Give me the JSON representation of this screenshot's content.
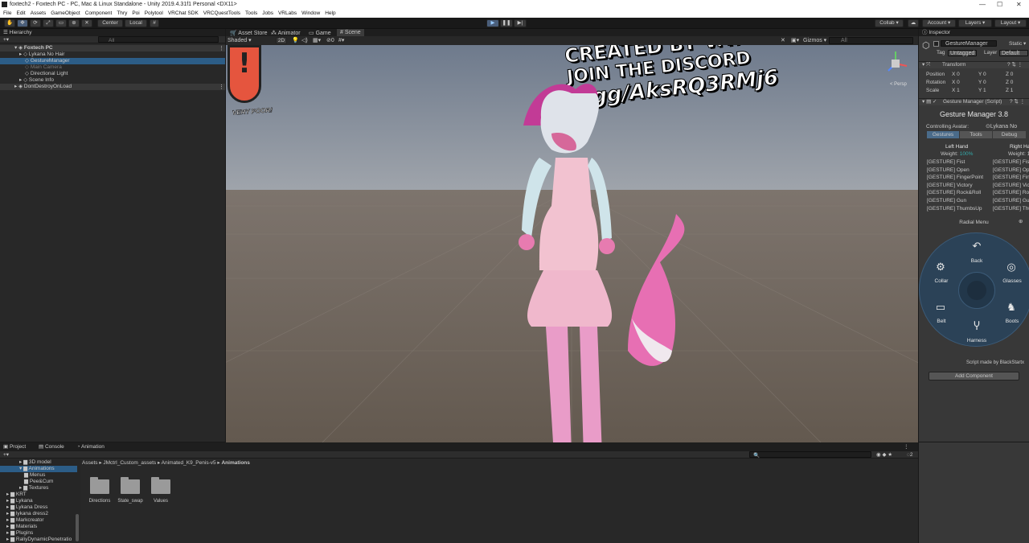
{
  "window": {
    "title": "foxtech2 - Foxtech PC - PC, Mac & Linux Standalone - Unity 2019.4.31f1 Personal <DX11>",
    "controls": [
      "—",
      "☐",
      "✕"
    ]
  },
  "menu": [
    "File",
    "Edit",
    "Assets",
    "GameObject",
    "Component",
    "Thry",
    "Poi",
    "Polytool",
    "VRChat SDK",
    "VRCQuestTools",
    "Tools",
    "Jobs",
    "VRLabs",
    "Window",
    "Help"
  ],
  "toolbar": {
    "center": "Center",
    "local": "Local",
    "collab": "Collab ▾",
    "account": "Account ▾",
    "layers": "Layers ▾",
    "layout": "Layout ▾"
  },
  "hierarchy": {
    "tab": "Hierarchy",
    "search_placeholder": "All",
    "items": [
      {
        "label": "Foxtech PC",
        "indent": 0,
        "bold": true
      },
      {
        "label": "Lykana No Hair",
        "indent": 1
      },
      {
        "label": "GestureManager",
        "indent": 1,
        "selected": true
      },
      {
        "label": "Main Camera",
        "indent": 1,
        "dim": true
      },
      {
        "label": "Directional Light",
        "indent": 1
      },
      {
        "label": "Scene Info",
        "indent": 1
      },
      {
        "label": "DontDestroyOnLoad",
        "indent": 0
      }
    ]
  },
  "scene": {
    "tabs": [
      "Asset Store",
      "Animator",
      "Game",
      "Scene"
    ],
    "active_tab": "Scene",
    "shading": "Shaded",
    "mode2d": "2D",
    "gizmos": "Gizmos ▾",
    "search_placeholder": "All",
    "persp": "< Persp",
    "sign_texts": [
      "CREATED BY V.T.",
      "JOIN THE DISCORD",
      "d.gg/AksRQ3RMj6"
    ],
    "perf_label": "VERY POOR!"
  },
  "inspector": {
    "tab": "Inspector",
    "object_name": "GestureManager",
    "static_label": "Static ▾",
    "tag_label": "Tag",
    "tag_value": "Untagged",
    "layer_label": "Layer",
    "layer_value": "Default",
    "transform": {
      "title": "Transform",
      "rows": [
        {
          "label": "Position",
          "x": "0",
          "y": "0",
          "z": "0"
        },
        {
          "label": "Rotation",
          "x": "0",
          "y": "0",
          "z": "0"
        },
        {
          "label": "Scale",
          "x": "1",
          "y": "1",
          "z": "1"
        }
      ]
    },
    "script": {
      "title": "Gesture Manager (Script)",
      "heading": "Gesture Manager 3.8",
      "controlling_label": "Controlling Avatar:",
      "controlling_value": "Lykana No",
      "tabs": [
        "Gestures",
        "Tools",
        "Debug"
      ],
      "left_hand": "Left Hand",
      "right_hand": "Right Ha",
      "weight_label": "Weight:",
      "weight_value": "100%",
      "weight_right": "Weight: 1",
      "gestures_left": [
        "[GESTURE] Fist",
        "[GESTURE] Open",
        "[GESTURE] FingerPoint",
        "[GESTURE] Victory",
        "[GESTURE] Rock&Roll",
        "[GESTURE] Gun",
        "[GESTURE] ThumbsUp"
      ],
      "gestures_right": [
        "[GESTURE] Fist",
        "[GESTURE] Ope",
        "[GESTURE] Fing",
        "[GESTURE] Victo",
        "[GESTURE] Roc",
        "[GESTURE] Gun",
        "[GESTURE] Thum"
      ],
      "radial_title": "Radial Menu",
      "radial": {
        "back": "Back",
        "collar": "Collar",
        "glasses": "Glasses",
        "belt": "Belt",
        "boots": "Boots",
        "harness": "Harness"
      },
      "credit": "Script made by BlackStartx"
    },
    "add_component": "Add Component"
  },
  "project": {
    "tabs": [
      "Project",
      "Console",
      "Animation"
    ],
    "tree": [
      {
        "label": "3D model",
        "indent": 1
      },
      {
        "label": "Animations",
        "indent": 1,
        "selected": true
      },
      {
        "label": "Menus",
        "indent": 2
      },
      {
        "label": "Pee&Cum",
        "indent": 2
      },
      {
        "label": "Textures",
        "indent": 2
      },
      {
        "label": "KRT",
        "indent": 0
      },
      {
        "label": "Lykana",
        "indent": 0
      },
      {
        "label": "Lykana Dress",
        "indent": 0
      },
      {
        "label": "lykana dress2",
        "indent": 0
      },
      {
        "label": "Markcreator",
        "indent": 0
      },
      {
        "label": "Materials",
        "indent": 0
      },
      {
        "label": "Plugins",
        "indent": 0
      },
      {
        "label": "RaliyDynamicPenetratio",
        "indent": 0
      }
    ],
    "breadcrumb": [
      "Assets",
      "JMctrl_Custom_assets",
      "Animated_K9_Penis-v5",
      "Animations"
    ],
    "folders": [
      "Directions",
      "State_swap",
      "Values"
    ],
    "count": "2"
  }
}
